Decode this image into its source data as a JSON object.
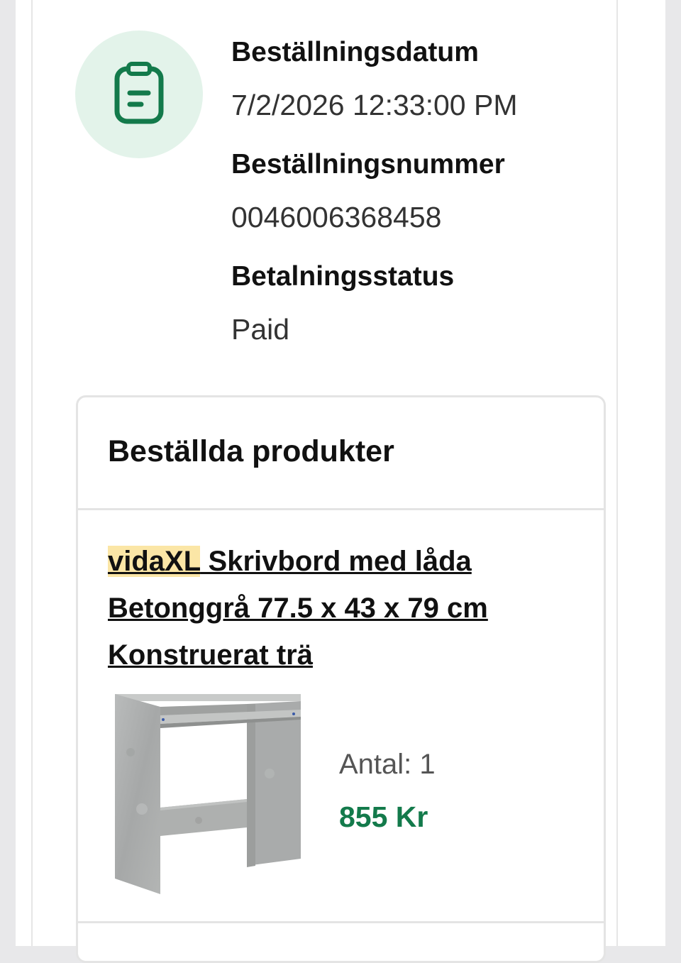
{
  "order_info": {
    "date_label": "Beställningsdatum",
    "date_value": "7/2/2026 12:33:00 PM",
    "number_label": "Beställningsnummer",
    "number_value": "0046006368458",
    "payment_label": "Betalningsstatus",
    "payment_value": "Paid",
    "icon": "clipboard-icon"
  },
  "products": {
    "title": "Beställda produkter",
    "items": [
      {
        "brand": "vidaXL",
        "name": " Skrivbord med låda Betonggrå 77.5 x 43 x 79 cm Konstruerat trä",
        "quantity_text": "Antal: 1",
        "price": "855 Kr",
        "image": "concrete-grey-desk-image"
      }
    ]
  },
  "colors": {
    "accent_green": "#137a4b",
    "icon_circle_bg": "#e3f3ea",
    "brand_highlight": "#fbe6a6"
  }
}
